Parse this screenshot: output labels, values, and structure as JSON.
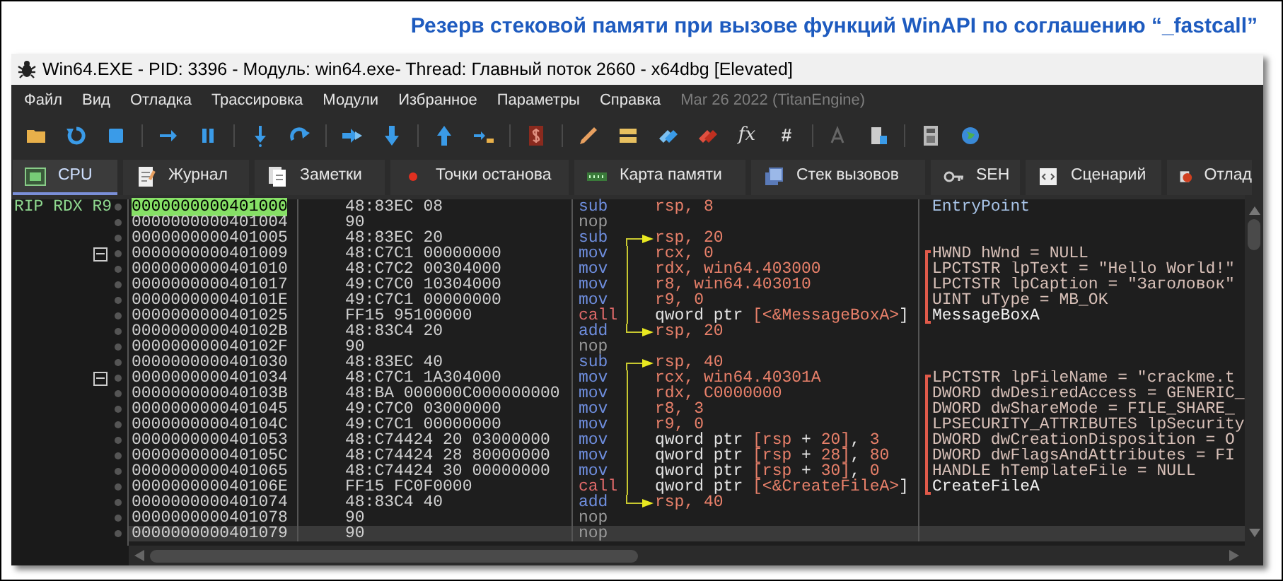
{
  "heading": "Резерв стековой памяти при вызове функций WinAPI по соглашению “_fastcall”",
  "window": {
    "title": "Win64.EXE - PID: 3396 - Модуль: win64.exe- Thread: Главный поток 2660 - x64dbg [Elevated]"
  },
  "menu": [
    "Файл",
    "Вид",
    "Отладка",
    "Трассировка",
    "Модули",
    "Избранное",
    "Параметры",
    "Справка"
  ],
  "build_info": "Mar 26 2022 (TitanEngine)",
  "toolbar_glyphs": [
    "fx",
    "#"
  ],
  "tabs": [
    {
      "label": "CPU",
      "selected": true
    },
    {
      "label": "Журнал",
      "selected": false
    },
    {
      "label": "Заметки",
      "selected": false
    },
    {
      "label": "Точки останова",
      "selected": false
    },
    {
      "label": "Карта памяти",
      "selected": false
    },
    {
      "label": "Стек вызовов",
      "selected": false
    },
    {
      "label": "SEH",
      "selected": false
    },
    {
      "label": "Сценарий",
      "selected": false
    },
    {
      "label": "Отлад",
      "selected": false
    }
  ],
  "rows": [
    {
      "registers": "RIP RDX R9",
      "address": "0000000000401000",
      "bytes": "48:83EC 08",
      "mnemonic": "sub",
      "kind": "op",
      "operands": [
        {
          "t": "rsp, 8",
          "kind": "hl"
        }
      ],
      "comment": {
        "text": "EntryPoint",
        "kind": "label"
      },
      "current": true,
      "selected": false,
      "fold": false
    },
    {
      "address": "0000000000401004",
      "bytes": "90",
      "mnemonic": "nop",
      "kind": "nop",
      "operands": [],
      "current": false,
      "selected": false,
      "fold": false
    },
    {
      "address": "0000000000401005",
      "bytes": "48:83EC 20",
      "mnemonic": "sub",
      "kind": "op",
      "operands": [
        {
          "t": "rsp, 20",
          "kind": "hl"
        }
      ],
      "jump": {
        "kind": "start"
      },
      "current": false,
      "selected": false,
      "fold": false
    },
    {
      "address": "0000000000401009",
      "bytes": "48:C7C1 00000000",
      "mnemonic": "mov",
      "kind": "op",
      "operands": [
        {
          "t": "rcx, 0",
          "kind": "hl"
        }
      ],
      "jump": {
        "kind": "middle"
      },
      "comment": {
        "text": "HWND hWnd = NULL",
        "kind": "arg",
        "bracket": {
          "kind": "start"
        }
      },
      "current": false,
      "selected": false,
      "fold": true
    },
    {
      "address": "0000000000401010",
      "bytes": "48:C7C2 00304000",
      "mnemonic": "mov",
      "kind": "op",
      "operands": [
        {
          "t": "rdx, win64.403000",
          "kind": "hl"
        }
      ],
      "jump": {
        "kind": "middle"
      },
      "comment": {
        "text": "LPCTSTR lpText = \"Hello World!\"",
        "kind": "arg",
        "bracket": {
          "kind": "middle"
        }
      },
      "current": false,
      "selected": false,
      "fold": false
    },
    {
      "address": "0000000000401017",
      "bytes": "49:C7C0 10304000",
      "mnemonic": "mov",
      "kind": "op",
      "operands": [
        {
          "t": "r8, win64.403010",
          "kind": "hl"
        }
      ],
      "jump": {
        "kind": "middle"
      },
      "comment": {
        "text": "LPCTSTR lpCaption = \"Заголовок\"",
        "kind": "arg",
        "bracket": {
          "kind": "middle"
        }
      },
      "current": false,
      "selected": false,
      "fold": false
    },
    {
      "address": "000000000040101E",
      "bytes": "49:C7C1 00000000",
      "mnemonic": "mov",
      "kind": "op",
      "operands": [
        {
          "t": "r9, 0",
          "kind": "hl"
        }
      ],
      "jump": {
        "kind": "middle"
      },
      "comment": {
        "text": "UINT uType = MB_OK",
        "kind": "arg",
        "bracket": {
          "kind": "middle"
        }
      },
      "current": false,
      "selected": false,
      "fold": false
    },
    {
      "address": "0000000000401025",
      "bytes": "FF15 95100000",
      "mnemonic": "call",
      "kind": "call",
      "operands": [
        {
          "t": "qword ptr ",
          "kind": "plain"
        },
        {
          "t": "[<&MessageBoxA>",
          "kind": "hl"
        },
        {
          "t": "]",
          "kind": "plain"
        }
      ],
      "jump": {
        "kind": "middle"
      },
      "comment": {
        "text": "MessageBoxA",
        "kind": "call",
        "bracket": {
          "kind": "end"
        }
      },
      "current": false,
      "selected": false,
      "fold": false
    },
    {
      "address": "000000000040102B",
      "bytes": "48:83C4 20",
      "mnemonic": "add",
      "kind": "op",
      "operands": [
        {
          "t": "rsp, 20",
          "kind": "hl"
        }
      ],
      "jump": {
        "kind": "end"
      },
      "current": false,
      "selected": false,
      "fold": false
    },
    {
      "address": "000000000040102F",
      "bytes": "90",
      "mnemonic": "nop",
      "kind": "nop",
      "operands": [],
      "current": false,
      "selected": false,
      "fold": false
    },
    {
      "address": "0000000000401030",
      "bytes": "48:83EC 40",
      "mnemonic": "sub",
      "kind": "op",
      "operands": [
        {
          "t": "rsp, 40",
          "kind": "hl"
        }
      ],
      "jump": {
        "kind": "start"
      },
      "current": false,
      "selected": false,
      "fold": false
    },
    {
      "address": "0000000000401034",
      "bytes": "48:C7C1 1A304000",
      "mnemonic": "mov",
      "kind": "op",
      "operands": [
        {
          "t": "rcx, win64.40301A",
          "kind": "hl"
        }
      ],
      "jump": {
        "kind": "middle"
      },
      "comment": {
        "text": "LPCTSTR lpFileName = \"crackme.t",
        "kind": "arg",
        "bracket": {
          "kind": "start"
        }
      },
      "current": false,
      "selected": false,
      "fold": true
    },
    {
      "address": "000000000040103B",
      "bytes": "48:BA 000000C000000000",
      "mnemonic": "mov",
      "kind": "op",
      "operands": [
        {
          "t": "rdx, C0000000",
          "kind": "hl"
        }
      ],
      "jump": {
        "kind": "middle"
      },
      "comment": {
        "text": "DWORD dwDesiredAccess = GENERIC_",
        "kind": "arg",
        "bracket": {
          "kind": "middle"
        }
      },
      "current": false,
      "selected": false,
      "fold": false
    },
    {
      "address": "0000000000401045",
      "bytes": "49:C7C0 03000000",
      "mnemonic": "mov",
      "kind": "op",
      "operands": [
        {
          "t": "r8, 3",
          "kind": "hl"
        }
      ],
      "jump": {
        "kind": "middle"
      },
      "comment": {
        "text": "DWORD dwShareMode = FILE_SHARE_",
        "kind": "arg",
        "bracket": {
          "kind": "middle"
        }
      },
      "current": false,
      "selected": false,
      "fold": false
    },
    {
      "address": "000000000040104C",
      "bytes": "49:C7C1 00000000",
      "mnemonic": "mov",
      "kind": "op",
      "operands": [
        {
          "t": "r9, 0",
          "kind": "hl"
        }
      ],
      "jump": {
        "kind": "middle"
      },
      "comment": {
        "text": "LPSECURITY_ATTRIBUTES lpSecurity",
        "kind": "arg",
        "bracket": {
          "kind": "middle"
        }
      },
      "current": false,
      "selected": false,
      "fold": false
    },
    {
      "address": "0000000000401053",
      "bytes": "48:C74424 20 03000000",
      "mnemonic": "mov",
      "kind": "op",
      "operands": [
        {
          "t": "qword ptr ",
          "kind": "plain"
        },
        {
          "t": "[rsp",
          "kind": "hl"
        },
        {
          "t": " + ",
          "kind": "plain"
        },
        {
          "t": "20]",
          "kind": "hl"
        },
        {
          "t": ", ",
          "kind": "plain"
        },
        {
          "t": "3",
          "kind": "hl"
        }
      ],
      "jump": {
        "kind": "middle"
      },
      "comment": {
        "text": "DWORD dwCreationDisposition = O",
        "kind": "arg",
        "bracket": {
          "kind": "middle"
        }
      },
      "current": false,
      "selected": false,
      "fold": false
    },
    {
      "address": "000000000040105C",
      "bytes": "48:C74424 28 80000000",
      "mnemonic": "mov",
      "kind": "op",
      "operands": [
        {
          "t": "qword ptr ",
          "kind": "plain"
        },
        {
          "t": "[rsp",
          "kind": "hl"
        },
        {
          "t": " + ",
          "kind": "plain"
        },
        {
          "t": "28]",
          "kind": "hl"
        },
        {
          "t": ", ",
          "kind": "plain"
        },
        {
          "t": "80",
          "kind": "hl"
        }
      ],
      "jump": {
        "kind": "middle"
      },
      "comment": {
        "text": "DWORD dwFlagsAndAttributes = FI",
        "kind": "arg",
        "bracket": {
          "kind": "middle"
        }
      },
      "current": false,
      "selected": false,
      "fold": false
    },
    {
      "address": "0000000000401065",
      "bytes": "48:C74424 30 00000000",
      "mnemonic": "mov",
      "kind": "op",
      "operands": [
        {
          "t": "qword ptr ",
          "kind": "plain"
        },
        {
          "t": "[rsp",
          "kind": "hl"
        },
        {
          "t": " + ",
          "kind": "plain"
        },
        {
          "t": "30]",
          "kind": "hl"
        },
        {
          "t": ", ",
          "kind": "plain"
        },
        {
          "t": "0",
          "kind": "hl"
        }
      ],
      "jump": {
        "kind": "middle"
      },
      "comment": {
        "text": "HANDLE hTemplateFile = NULL",
        "kind": "arg",
        "bracket": {
          "kind": "middle"
        }
      },
      "current": false,
      "selected": false,
      "fold": false
    },
    {
      "address": "000000000040106E",
      "bytes": "FF15 FC0F0000",
      "mnemonic": "call",
      "kind": "call",
      "operands": [
        {
          "t": "qword ptr ",
          "kind": "plain"
        },
        {
          "t": "[<&CreateFileA>",
          "kind": "hl"
        },
        {
          "t": "]",
          "kind": "plain"
        }
      ],
      "jump": {
        "kind": "middle"
      },
      "comment": {
        "text": "CreateFileA",
        "kind": "call",
        "bracket": {
          "kind": "end"
        }
      },
      "current": false,
      "selected": false,
      "fold": false
    },
    {
      "address": "0000000000401074",
      "bytes": "48:83C4 40",
      "mnemonic": "add",
      "kind": "op",
      "operands": [
        {
          "t": "rsp, 40",
          "kind": "hl"
        }
      ],
      "jump": {
        "kind": "end"
      },
      "current": false,
      "selected": false,
      "fold": false
    },
    {
      "address": "0000000000401078",
      "bytes": "90",
      "mnemonic": "nop",
      "kind": "nop",
      "operands": [],
      "current": false,
      "selected": false,
      "fold": false
    },
    {
      "address": "0000000000401079",
      "bytes": "90",
      "mnemonic": "nop",
      "kind": "nop",
      "operands": [],
      "current": false,
      "selected": true,
      "fold": false
    }
  ]
}
